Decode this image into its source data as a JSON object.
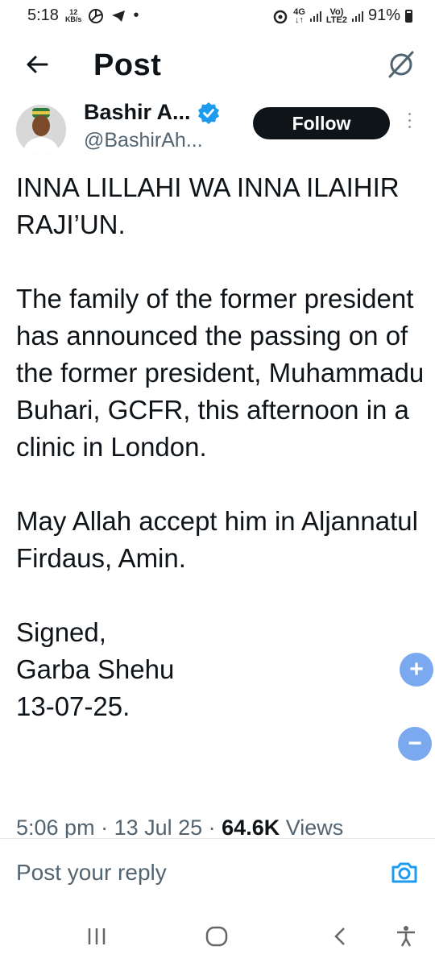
{
  "status_bar": {
    "time": "5:18",
    "speed_value": "12",
    "speed_unit": "KB/s",
    "dot": "•",
    "network_4g": "4G",
    "lte_top": "Vo)",
    "lte_bottom": "LTE2",
    "battery": "91%"
  },
  "header": {
    "title": "Post",
    "back_icon": "arrow-left-icon",
    "grok_icon": "grok-icon"
  },
  "author": {
    "name": "Bashir A...",
    "handle": "@BashirAh...",
    "follow_label": "Follow",
    "verified_color": "#1d9bf0"
  },
  "post": {
    "para1": "INNA LILLAHI WA INNA ILAIHIR RAJI’UN.",
    "para2": "The family of the former president has announced the passing on of the former president, Muhammadu Buhari, GCFR, this afternoon in a clinic in London.",
    "para3": "May Allah accept him in Aljannatul Firdaus, Amin.",
    "sign_line1": "Signed,",
    "sign_line2": "Garba Shehu",
    "sign_line3": "13-07-25."
  },
  "meta": {
    "time": "5:06 pm",
    "separator": " · ",
    "date": "13 Jul 25",
    "views_count": "64.6K",
    "views_label": "Views"
  },
  "zoom": {
    "in_label": "+",
    "out_label": "−"
  },
  "reply": {
    "placeholder": "Post your reply",
    "camera_icon": "camera-icon",
    "accent": "#1d9bf0"
  },
  "navbar": {
    "recent_icon": "recent-apps-icon",
    "home_icon": "home-icon",
    "back_icon": "nav-back-icon",
    "accessibility_icon": "accessibility-icon"
  }
}
